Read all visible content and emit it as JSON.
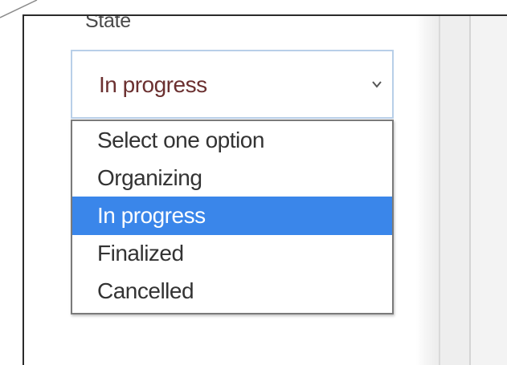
{
  "field": {
    "label": "State"
  },
  "select": {
    "current_value": "In progress",
    "arrow_icon": "chevron-down-icon",
    "options": [
      "Select one option",
      "Organizing",
      "In progress",
      "Finalized",
      "Cancelled"
    ],
    "selected_index": 2
  },
  "colors": {
    "highlight": "#3a86ea",
    "select_border": "#b8cfe8",
    "current_value_text": "#6b3030"
  }
}
